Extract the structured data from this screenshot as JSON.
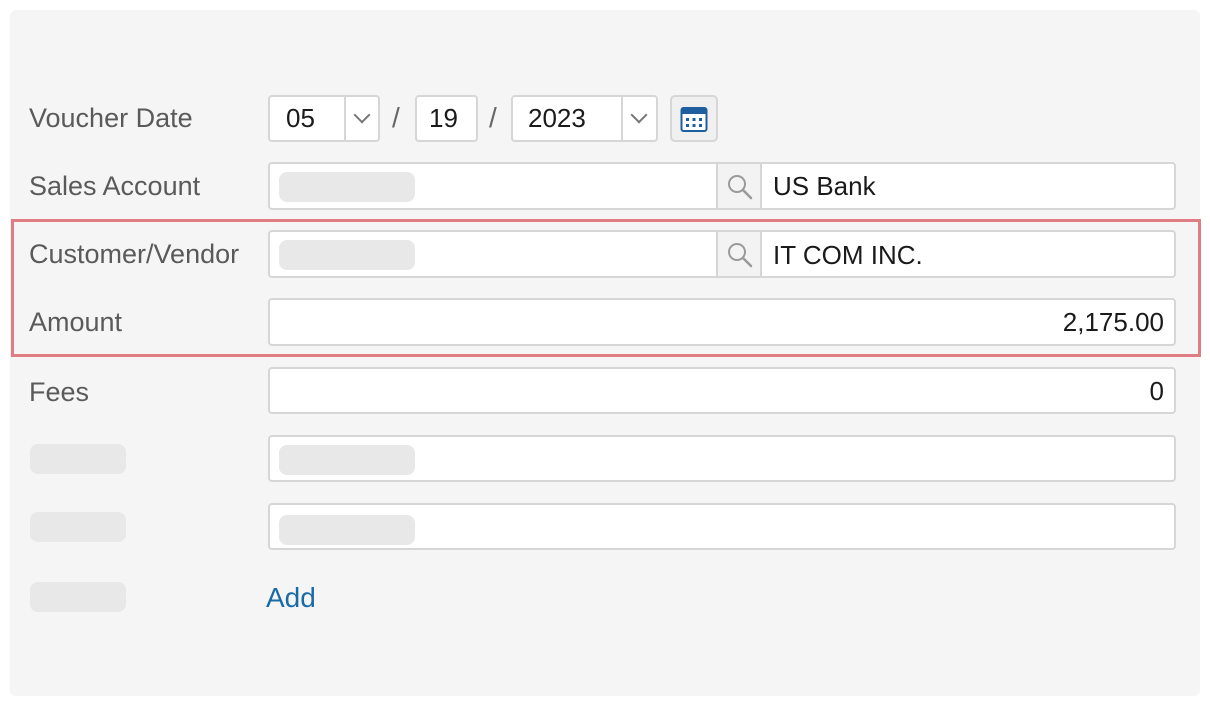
{
  "form": {
    "voucher_date": {
      "label": "Voucher Date",
      "month": "05",
      "day": "19",
      "year": "2023",
      "separator": "/",
      "calendar_icon": "calendar-icon"
    },
    "sales_account": {
      "label": "Sales Account",
      "name": "US Bank",
      "search_icon": "search-icon"
    },
    "customer_vendor": {
      "label": "Customer/Vendor",
      "name": "IT COM INC.",
      "search_icon": "search-icon"
    },
    "amount": {
      "label": "Amount",
      "value": "2,175.00"
    },
    "fees": {
      "label": "Fees",
      "value": "0"
    },
    "add_label": "Add"
  },
  "colors": {
    "panel_bg": "#f5f5f5",
    "highlight_border": "#e07c84",
    "link": "#1a6aa8",
    "calendar_icon": "#1f5fa0"
  }
}
